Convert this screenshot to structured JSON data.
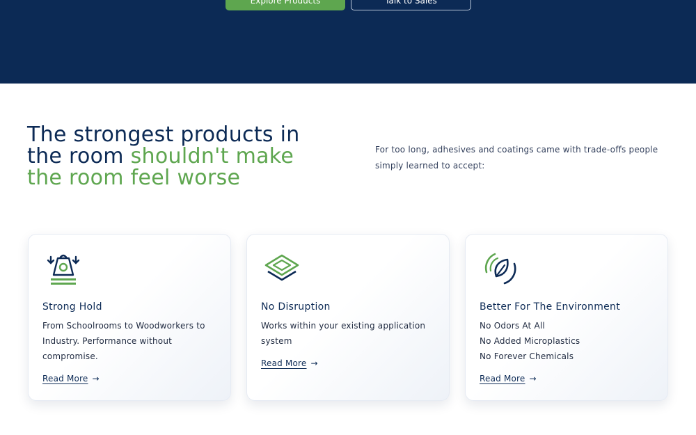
{
  "hero": {
    "primary_button": "Explore Products",
    "secondary_button": "Talk to Sales"
  },
  "headline": {
    "part1": "The strongest products in the room ",
    "part2": "shouldn't make the room feel worse"
  },
  "intro": "For too long, adhesives and coatings came with trade-offs people simply learned to accept:",
  "cards": [
    {
      "icon": "weight-icon",
      "title": "Strong Hold",
      "lines": [
        "From Schoolrooms to Woodworkers to",
        "Industry. Performance without",
        "compromise."
      ],
      "link": "Read More"
    },
    {
      "icon": "layers-icon",
      "title": "No Disruption",
      "lines": [
        "Works within your existing application",
        "system"
      ],
      "link": "Read More"
    },
    {
      "icon": "leaf-icon",
      "title": "Better For The Environment",
      "lines": [
        "No Odors At All",
        "No Added Microplastics",
        "No Forever Chemicals"
      ],
      "link": "Read More"
    }
  ],
  "colors": {
    "navy": "#0c2a55",
    "green": "#5ea64f"
  }
}
